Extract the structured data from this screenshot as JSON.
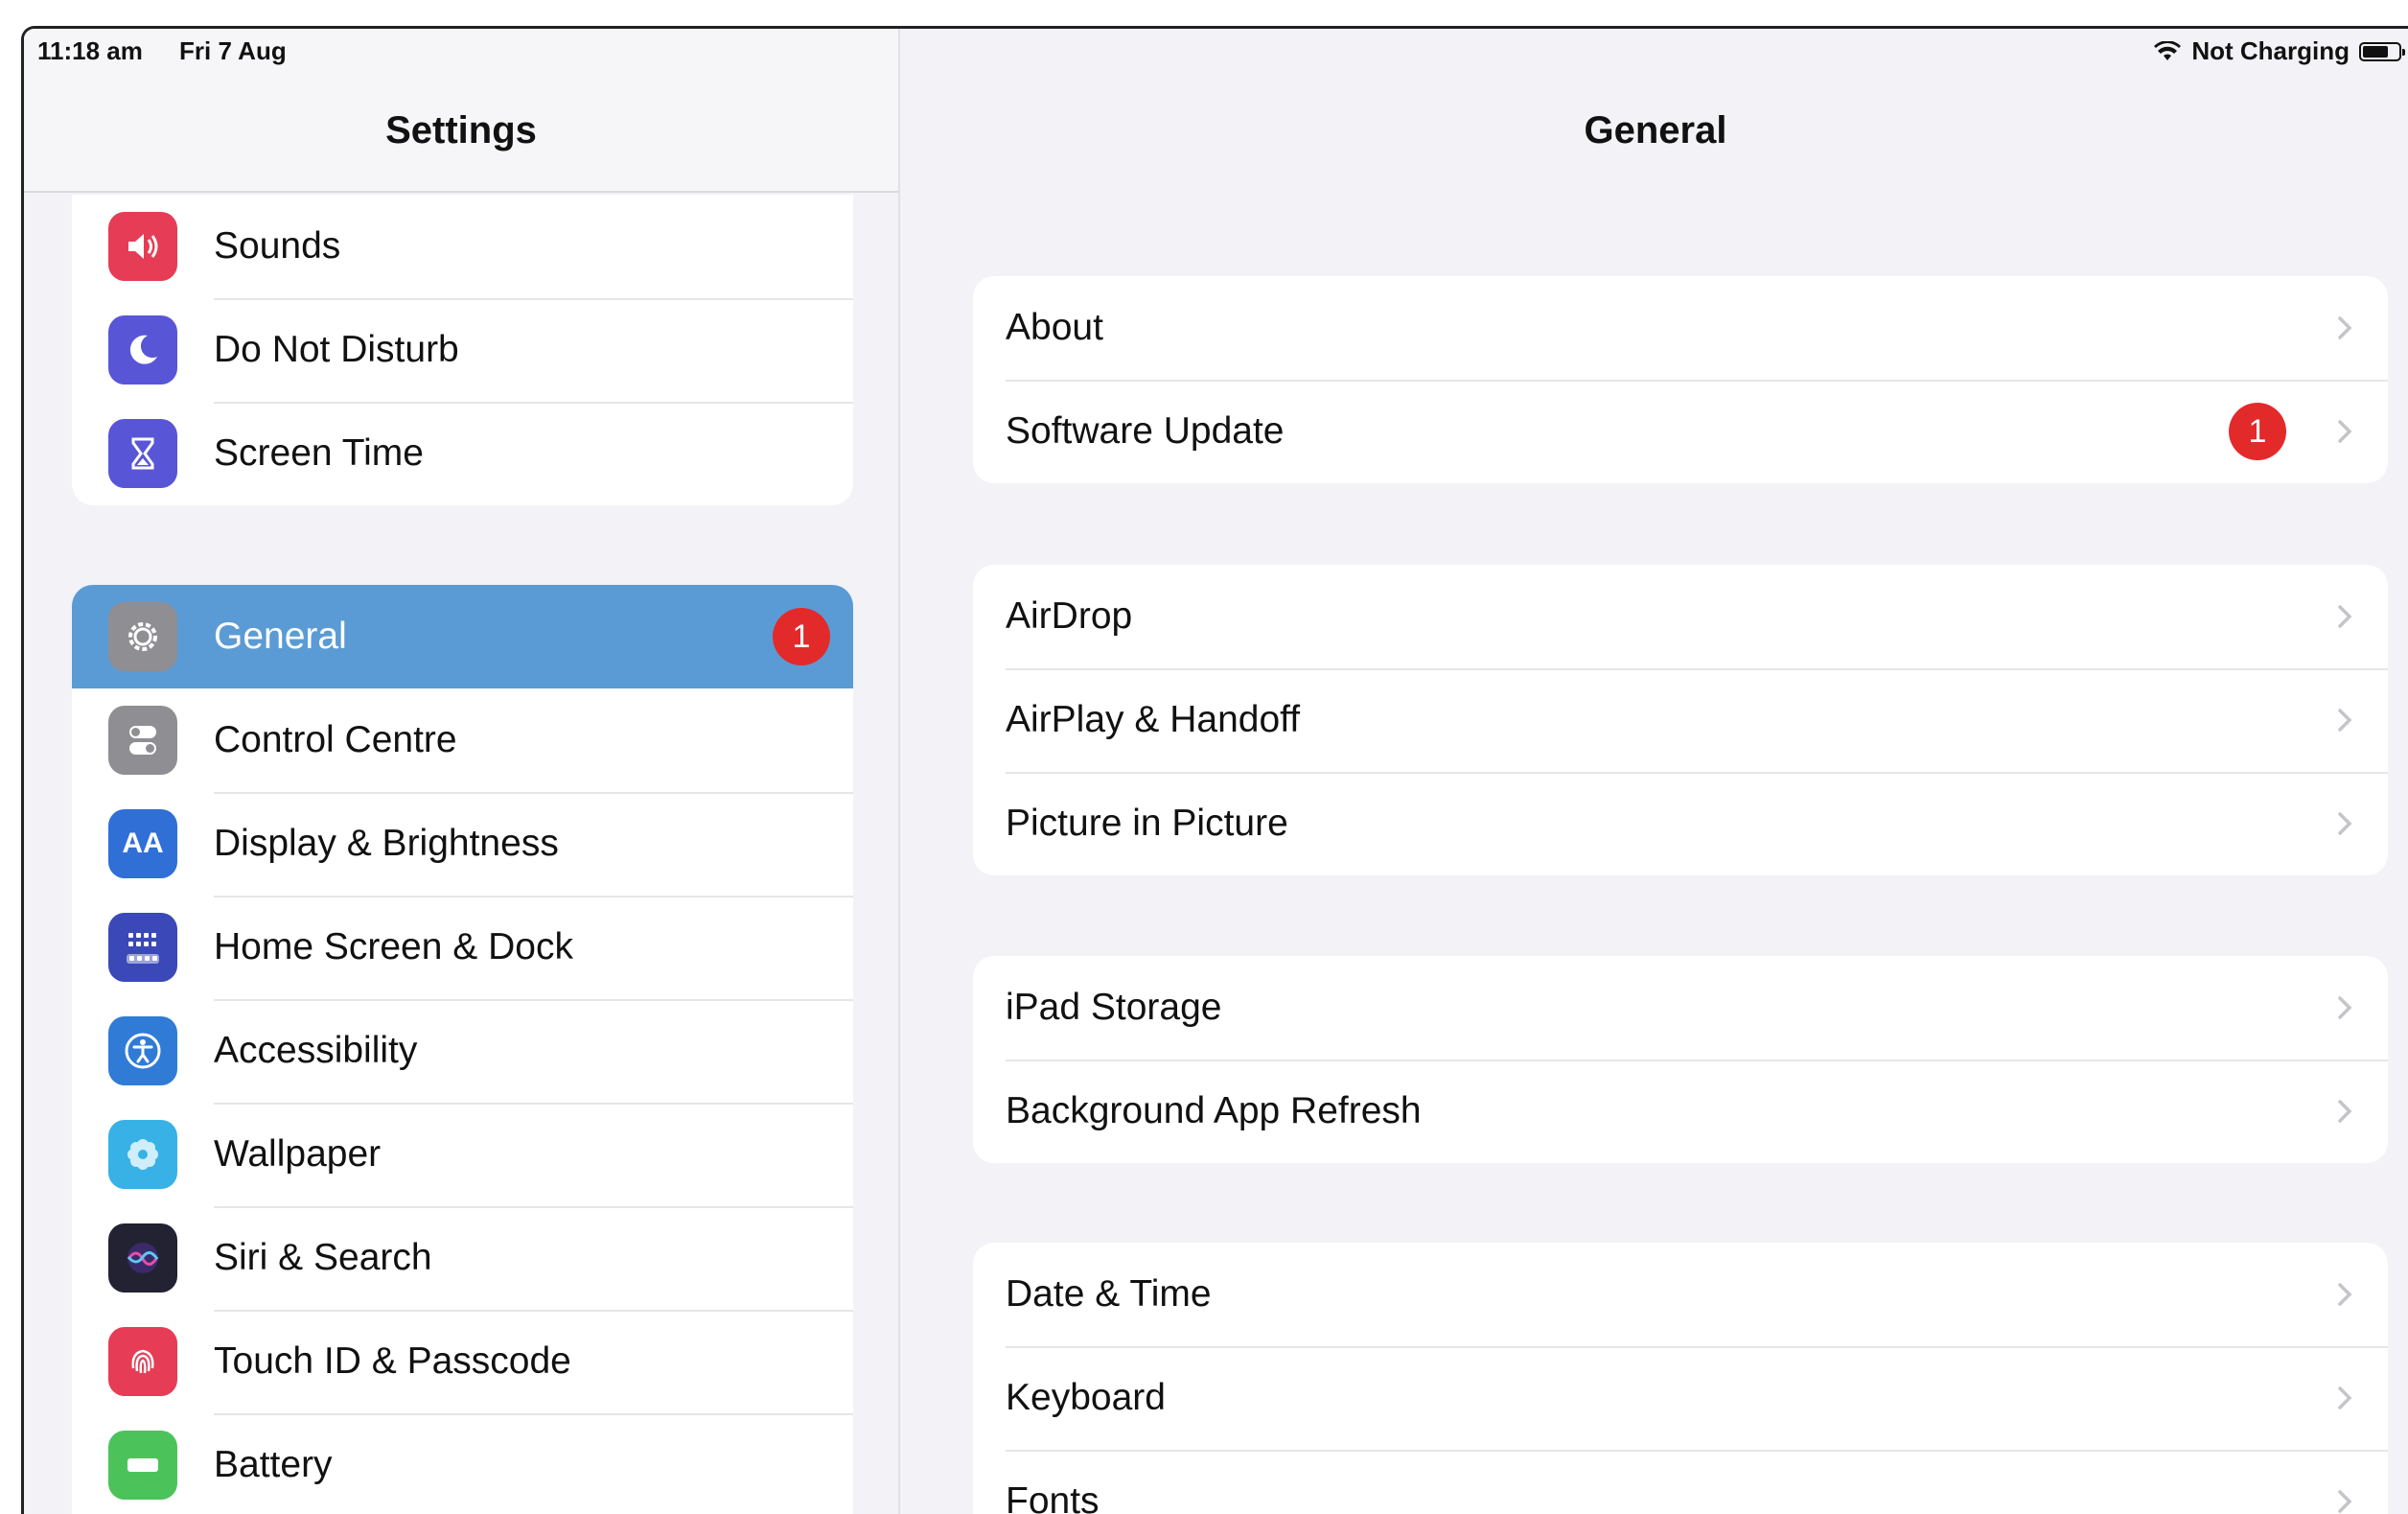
{
  "status_bar": {
    "time": "11:18 am",
    "date": "Fri 7 Aug",
    "charging": "Not Charging"
  },
  "sidebar": {
    "title": "Settings",
    "group1": [
      {
        "label": "Sounds",
        "icon": "speaker-icon",
        "color": "#e63c55"
      },
      {
        "label": "Do Not Disturb",
        "icon": "moon-icon",
        "color": "#5856d6"
      },
      {
        "label": "Screen Time",
        "icon": "hourglass-icon",
        "color": "#5856d6"
      }
    ],
    "group2": [
      {
        "label": "General",
        "icon": "gear-icon",
        "color": "#8e8e93",
        "badge": "1",
        "selected": true
      },
      {
        "label": "Control Centre",
        "icon": "toggles-icon",
        "color": "#8e8e93"
      },
      {
        "label": "Display & Brightness",
        "icon": "aa-icon",
        "icon_text": "AA",
        "color": "#2f6fd6"
      },
      {
        "label": "Home Screen & Dock",
        "icon": "grid-icon",
        "color": "#3a48b8"
      },
      {
        "label": "Accessibility",
        "icon": "accessibility-icon",
        "color": "#2f7bd6"
      },
      {
        "label": "Wallpaper",
        "icon": "flower-icon",
        "color": "#38b2e6"
      },
      {
        "label": "Siri & Search",
        "icon": "siri-icon",
        "color": "#222233"
      },
      {
        "label": "Touch ID & Passcode",
        "icon": "fingerprint-icon",
        "color": "#e63c55"
      },
      {
        "label": "Battery",
        "icon": "battery-icon",
        "color": "#4cc35a"
      }
    ]
  },
  "detail": {
    "title": "General",
    "groups": [
      [
        {
          "label": "About"
        },
        {
          "label": "Software Update",
          "badge": "1"
        }
      ],
      [
        {
          "label": "AirDrop"
        },
        {
          "label": "AirPlay & Handoff"
        },
        {
          "label": "Picture in Picture"
        }
      ],
      [
        {
          "label": "iPad Storage"
        },
        {
          "label": "Background App Refresh"
        }
      ],
      [
        {
          "label": "Date & Time"
        },
        {
          "label": "Keyboard"
        },
        {
          "label": "Fonts"
        }
      ]
    ]
  }
}
